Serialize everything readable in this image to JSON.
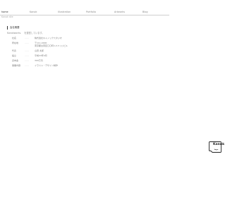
{
  "nav": {
    "items": [
      {
        "label": "home"
      },
      {
        "label": "Kanok"
      },
      {
        "label": "Illustration"
      },
      {
        "label": "Portfolio"
      },
      {
        "label": "Artworks"
      },
      {
        "label": "Blog"
      }
    ]
  },
  "header": {
    "subtitle": "Kanok site"
  },
  "main": {
    "section_title": "会社概要",
    "intro": [
      "Kanokworks.",
      "を運営しています。"
    ],
    "rows": [
      {
        "label": "社名",
        "sep": "……",
        "values": [
          "株式会社キャノックスタジオ"
        ]
      },
      {
        "label": "所在地",
        "sep": "……",
        "values": [
          "〒111-0000",
          "東京都台東区〇〇町1-2-3 ○○ビル"
        ]
      },
      {
        "label": "代表",
        "sep": "……",
        "values": [
          "山田 太郎"
        ]
      },
      {
        "label": "設立",
        "sep": "……",
        "values": [
          "平成24年4月"
        ]
      },
      {
        "label": "資本金",
        "sep": "……",
        "values": [
          "300万円"
        ]
      },
      {
        "label": "事業内容",
        "sep": "……",
        "values": [
          "イラスト・デザイン制作"
        ]
      }
    ]
  },
  "badge": {
    "label": "Kanok",
    "icon": "kanok-logo-badge"
  }
}
